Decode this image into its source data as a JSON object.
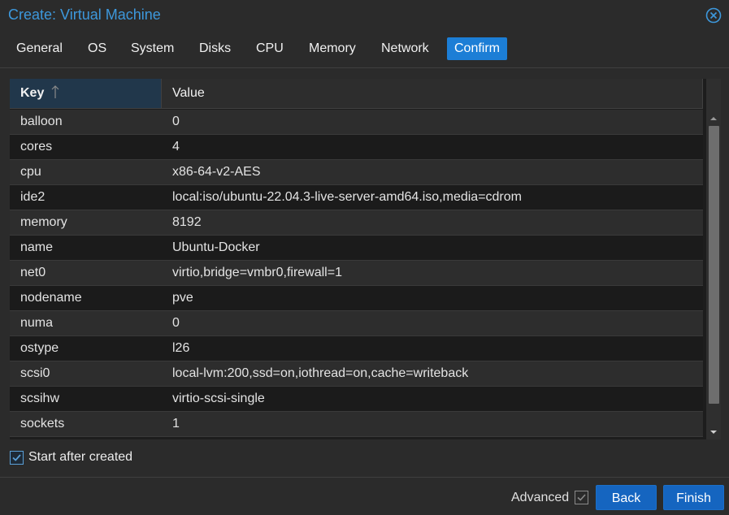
{
  "window": {
    "title": "Create: Virtual Machine",
    "accent_color": "#3d98dc",
    "close_icon": "close-circle-icon"
  },
  "tabs": [
    {
      "label": "General",
      "active": false
    },
    {
      "label": "OS",
      "active": false
    },
    {
      "label": "System",
      "active": false
    },
    {
      "label": "Disks",
      "active": false
    },
    {
      "label": "CPU",
      "active": false
    },
    {
      "label": "Memory",
      "active": false
    },
    {
      "label": "Network",
      "active": false
    },
    {
      "label": "Confirm",
      "active": true
    }
  ],
  "grid": {
    "columns": {
      "key": "Key",
      "value": "Value"
    },
    "sort": {
      "column": "key",
      "direction": "ascending",
      "icon": "arrow-up-icon"
    },
    "rows": [
      {
        "key": "balloon",
        "value": "0"
      },
      {
        "key": "cores",
        "value": "4"
      },
      {
        "key": "cpu",
        "value": "x86-64-v2-AES"
      },
      {
        "key": "ide2",
        "value": "local:iso/ubuntu-22.04.3-live-server-amd64.iso,media=cdrom"
      },
      {
        "key": "memory",
        "value": "8192"
      },
      {
        "key": "name",
        "value": "Ubuntu-Docker"
      },
      {
        "key": "net0",
        "value": "virtio,bridge=vmbr0,firewall=1"
      },
      {
        "key": "nodename",
        "value": "pve"
      },
      {
        "key": "numa",
        "value": "0"
      },
      {
        "key": "ostype",
        "value": "l26"
      },
      {
        "key": "scsi0",
        "value": "local-lvm:200,ssd=on,iothread=on,cache=writeback"
      },
      {
        "key": "scsihw",
        "value": "virtio-scsi-single"
      },
      {
        "key": "sockets",
        "value": "1"
      }
    ]
  },
  "options": {
    "start_after_created": {
      "label": "Start after created",
      "checked": true
    }
  },
  "footer": {
    "advanced_label": "Advanced",
    "advanced_checked": true,
    "back_label": "Back",
    "finish_label": "Finish",
    "button_color": "#1565c0"
  }
}
